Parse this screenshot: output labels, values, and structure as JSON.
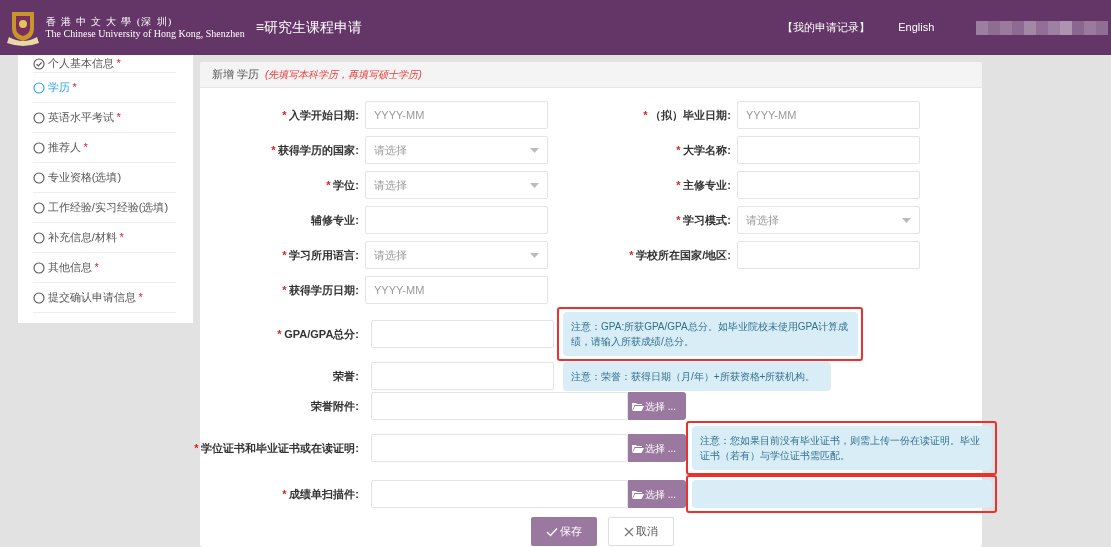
{
  "header": {
    "university_cn": "香 港 中 文 大 學 (深 圳)",
    "university_en": "The Chinese University of Hong Kong, Shenzhen",
    "menu_glyph": "≡",
    "title": "研究生课程申请",
    "links": [
      "【我的申请记录】",
      "English"
    ]
  },
  "sidebar": {
    "items": [
      {
        "label": "个人基本信息",
        "required_mark": "*",
        "completed": true,
        "selected": false
      },
      {
        "label": "学历",
        "required_mark": "*",
        "completed": false,
        "selected": true
      },
      {
        "label": "英语水平考试",
        "required_mark": "*",
        "completed": false,
        "selected": false
      },
      {
        "label": "推荐人",
        "required_mark": "*",
        "completed": false,
        "selected": false
      },
      {
        "label": "专业资格(选填)",
        "completed": false,
        "selected": false
      },
      {
        "label": "工作经验/实习经验(选填)",
        "completed": false,
        "selected": false
      },
      {
        "label": "补充信息/材料",
        "required_mark": "*",
        "completed": false,
        "selected": false
      },
      {
        "label": "其他信息",
        "required_mark": "*",
        "completed": false,
        "selected": false
      },
      {
        "label": "提交确认申请信息",
        "required_mark": "*",
        "completed": false,
        "selected": false
      }
    ]
  },
  "panel": {
    "title": "新增 学历",
    "hint": "(先填写本科学历，再填写硕士学历)"
  },
  "form_rows": [
    {
      "left": {
        "label": "入学开始日期:",
        "required_mark": "*",
        "kind": "text",
        "placeholder": "YYYY-MM"
      },
      "right": {
        "label": "（拟）毕业日期:",
        "required_mark": "*",
        "kind": "text",
        "placeholder": "YYYY-MM"
      }
    },
    {
      "left": {
        "label": "获得学历的国家:",
        "required_mark": "*",
        "kind": "select",
        "placeholder": "请选择"
      },
      "right": {
        "label": "大学名称:",
        "required_mark": "*",
        "kind": "text"
      }
    },
    {
      "left": {
        "label": "学位:",
        "required_mark": "*",
        "kind": "select",
        "placeholder": "请选择"
      },
      "right": {
        "label": "主修专业:",
        "required_mark": "*",
        "kind": "text"
      }
    },
    {
      "left": {
        "label": "辅修专业:",
        "kind": "text"
      },
      "right": {
        "label": "学习模式:",
        "required_mark": "*",
        "kind": "select",
        "placeholder": "请选择"
      }
    },
    {
      "left": {
        "label": "学习所用语言:",
        "required_mark": "*",
        "kind": "select",
        "placeholder": "请选择"
      },
      "right": {
        "label": "学校所在国家/地区:",
        "required_mark": "*",
        "kind": "text"
      }
    },
    {
      "left": {
        "label": "获得学历日期:",
        "required_mark": "*",
        "kind": "text",
        "placeholder": "YYYY-MM"
      }
    }
  ],
  "detail_rows": [
    {
      "label": "GPA/GPA总分:",
      "required_mark": "*",
      "kind": "text",
      "note": {
        "text": "注意：GPA:所获GPA/GPA总分。如毕业院校未使用GPA计算成绩，请输入所获成绩/总分。",
        "highlighted": true
      }
    },
    {
      "label": "荣誉:",
      "kind": "text",
      "note": {
        "text": "注意：荣誉：获得日期（月/年）+所获资格+所获机构。",
        "highlighted": false
      }
    },
    {
      "label": "荣誉附件:",
      "kind": "file",
      "button": "选择 ..."
    },
    {
      "label": "学位证书和毕业证书或在读证明:",
      "required_mark": "*",
      "kind": "file",
      "button": "选择 ...",
      "note": {
        "text": "注意：您如果目前没有毕业证书，则需上传一份在读证明。毕业证书（若有）与学位证书需匹配。",
        "highlighted": true
      }
    },
    {
      "label": "成绩单扫描件:",
      "required_mark": "*",
      "kind": "file",
      "button": "选择 ...",
      "note": {
        "highlighted": true
      }
    }
  ],
  "actions": [
    {
      "label": "保存",
      "kind": "primary"
    },
    {
      "label": "取消",
      "kind": "secondary"
    }
  ]
}
